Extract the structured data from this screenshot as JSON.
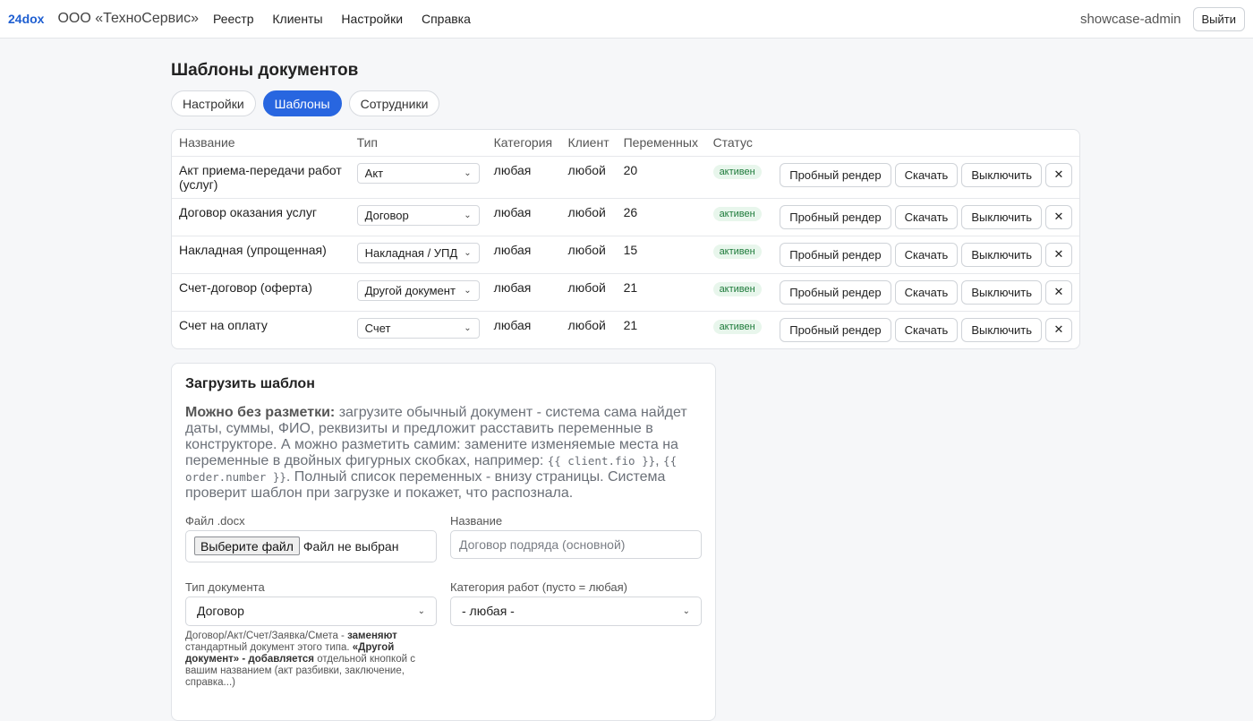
{
  "topbar": {
    "brand": "24dox",
    "org": "ООО «ТехноСервис»",
    "nav": [
      "Реестр",
      "Клиенты",
      "Настройки",
      "Справка"
    ],
    "user": "showcase-admin",
    "logout": "Выйти"
  },
  "page": {
    "title": "Шаблоны документов",
    "tabs": [
      {
        "label": "Настройки"
      },
      {
        "label": "Шаблоны"
      },
      {
        "label": "Сотрудники"
      }
    ]
  },
  "table": {
    "headers": [
      "Название",
      "Тип",
      "Категория",
      "Клиент",
      "Переменных",
      "Статус"
    ],
    "rows": [
      {
        "name": "Акт приема-передачи работ (услуг)",
        "type": "Акт",
        "category": "любая",
        "client": "любой",
        "vars": "20",
        "status": "активен"
      },
      {
        "name": "Договор оказания услуг",
        "type": "Договор",
        "category": "любая",
        "client": "любой",
        "vars": "26",
        "status": "активен"
      },
      {
        "name": "Накладная (упрощенная)",
        "type": "Накладная / УПД",
        "category": "любая",
        "client": "любой",
        "vars": "15",
        "status": "активен"
      },
      {
        "name": "Счет-договор (оферта)",
        "type": "Другой документ",
        "category": "любая",
        "client": "любой",
        "vars": "21",
        "status": "активен"
      },
      {
        "name": "Счет на оплату",
        "type": "Счет",
        "category": "любая",
        "client": "любой",
        "vars": "21",
        "status": "активен"
      }
    ],
    "actions": {
      "render": "Пробный рендер",
      "download": "Скачать",
      "disable": "Выключить",
      "delete": "✕"
    }
  },
  "upload": {
    "title": "Загрузить шаблон",
    "hint_bold": "Можно без разметки:",
    "hint_1": " загрузите обычный документ - система сама найдет даты, суммы, ФИО, реквизиты и предложит расставить переменные в конструкторе. А можно разметить самим: замените изменяемые места на переменные в двойных фигурных скобках, например: ",
    "code_1": "{{ client.fio }}",
    "hint_sep": ", ",
    "code_2": "{{ order.number }}",
    "hint_2": ". Полный список переменных - внизу страницы. Система проверит шаблон при загрузке и покажет, что распознала.",
    "file_label": "Файл .docx",
    "file_button": "Выберите файл",
    "file_status": "Файл не выбран",
    "name_label": "Название",
    "name_placeholder": "Договор подряда (основной)",
    "doctype_label": "Тип документа",
    "doctype_value": "Договор",
    "category_label": "Категория работ (пусто = любая)",
    "category_value": "- любая -",
    "note_1": "Договор/Акт/Счет/Заявка/Смета - ",
    "note_b1": "заменяют",
    "note_2": " стандартный документ этого типа. ",
    "note_b2": "«Другой документ» - добавляется",
    "note_3": " отдельной кнопкой с вашим названием (акт разбивки, заключение, справка...)"
  },
  "colors": {
    "accent": "#2866e0",
    "brand": "#1f5fd1",
    "active_badge_bg": "#e8f6ec",
    "active_badge_fg": "#1d7a3a"
  }
}
